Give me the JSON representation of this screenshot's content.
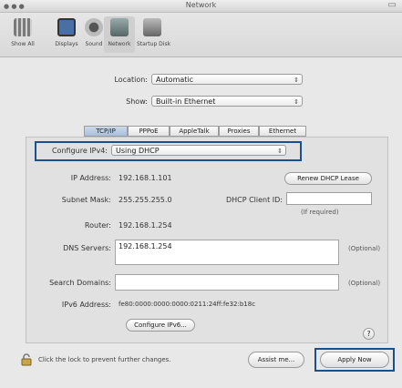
{
  "window": {
    "title": "Network"
  },
  "toolbar": {
    "items": [
      {
        "label": "Show All"
      },
      {
        "label": "Displays"
      },
      {
        "label": "Sound"
      },
      {
        "label": "Network"
      },
      {
        "label": "Startup Disk"
      }
    ]
  },
  "location": {
    "label": "Location:",
    "value": "Automatic"
  },
  "show": {
    "label": "Show:",
    "value": "Built-in Ethernet"
  },
  "tabs": [
    "TCP/IP",
    "PPPoE",
    "AppleTalk",
    "Proxies",
    "Ethernet"
  ],
  "tcpip": {
    "configure_label": "Configure IPv4:",
    "configure_value": "Using DHCP",
    "ip_label": "IP Address:",
    "ip_value": "192.168.1.101",
    "renew_button": "Renew DHCP Lease",
    "subnet_label": "Subnet Mask:",
    "subnet_value": "255.255.255.0",
    "client_id_label": "DHCP Client ID:",
    "client_id_note": "(If required)",
    "router_label": "Router:",
    "router_value": "192.168.1.254",
    "dns_label": "DNS Servers:",
    "dns_value": "192.168.1.254",
    "dns_optional": "(Optional)",
    "search_label": "Search Domains:",
    "search_optional": "(Optional)",
    "ipv6_label": "IPv6 Address:",
    "ipv6_value": "fe80:0000:0000:0000:0211:24ff:fe32:b18c",
    "configure_ipv6_button": "Configure IPv6...",
    "help": "?"
  },
  "footer": {
    "lock_text": "Click the lock to prevent further changes.",
    "assist_button": "Assist me...",
    "apply_button": "Apply Now"
  },
  "colors": {
    "highlight": "#1c4f8c"
  }
}
